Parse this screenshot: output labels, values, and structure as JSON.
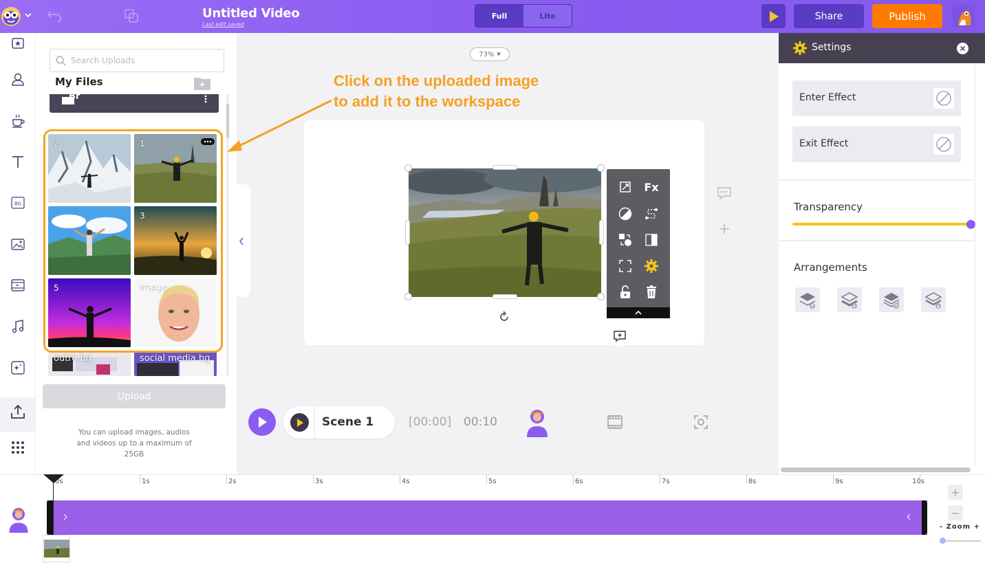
{
  "header": {
    "title": "Untitled Video",
    "subtitle": "Last edit saved",
    "mode_full": "Full",
    "mode_lite": "Lite",
    "share_label": "Share",
    "publish_label": "Publish"
  },
  "uploads": {
    "search_placeholder": "Search Uploads",
    "section_title": "My Files",
    "folder_name": "Br",
    "items": [
      {
        "label": "2"
      },
      {
        "label": "1"
      },
      {
        "label": ""
      },
      {
        "label": "3"
      },
      {
        "label": "5"
      },
      {
        "label": "image"
      },
      {
        "label": "outro bg"
      },
      {
        "label": "social media bg"
      }
    ],
    "upload_button": "Upload",
    "upload_note": "You can upload images, audios and videos up to a maximum of 25GB"
  },
  "annotation": {
    "line1": "Click on the uploaded image",
    "line2": "to add it to the workspace"
  },
  "canvas": {
    "zoom_level": "73%"
  },
  "toolbox": {
    "fx_label": "Fx"
  },
  "playback": {
    "scene_label": "Scene 1",
    "current_time": "[00:00]",
    "total_time": "00:10"
  },
  "settings": {
    "title": "Settings",
    "enter_effect": "Enter Effect",
    "exit_effect": "Exit Effect",
    "transparency_label": "Transparency",
    "transparency_value": 1.0,
    "arrangements_label": "Arrangements"
  },
  "timeline": {
    "ticks": [
      "0s",
      "1s",
      "2s",
      "3s",
      "4s",
      "5s",
      "6s",
      "7s",
      "8s",
      "9s",
      "10s"
    ],
    "zoom_label": "-  Zoom  +"
  },
  "colors": {
    "brand_purple": "#8b5cf0",
    "publish_orange": "#ff7a00",
    "annotation_orange": "#f5a023",
    "transparency_yellow": "#f5c518"
  }
}
